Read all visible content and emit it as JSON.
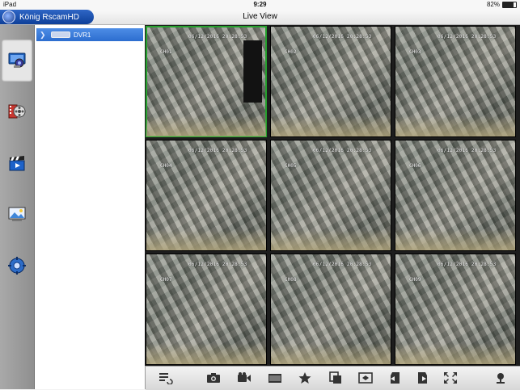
{
  "status_bar": {
    "device": "iPad",
    "time": "9:29",
    "battery": "82%"
  },
  "nav": {
    "app_name": "König RscamHD",
    "title": "Live View"
  },
  "sidebar": {
    "items": [
      {
        "id": "live-view",
        "icon": "monitor-icon",
        "active": true
      },
      {
        "id": "playback",
        "icon": "film-reel-icon",
        "active": false
      },
      {
        "id": "video-files",
        "icon": "clapperboard-icon",
        "active": false
      },
      {
        "id": "image-files",
        "icon": "picture-icon",
        "active": false
      },
      {
        "id": "settings",
        "icon": "settings-gear-icon",
        "active": false
      }
    ]
  },
  "device_tree": {
    "devices": [
      {
        "name": "DVR1",
        "expanded": false
      }
    ]
  },
  "grid": {
    "cells": [
      {
        "channel": "CH01",
        "timestamp": "06/12/2016 20:28:53",
        "selected": true
      },
      {
        "channel": "CH02",
        "timestamp": "06/12/2016 20:28:53",
        "selected": false
      },
      {
        "channel": "CH03",
        "timestamp": "06/12/2016 20:28:53",
        "selected": false
      },
      {
        "channel": "CH04",
        "timestamp": "06/12/2016 20:28:53",
        "selected": false
      },
      {
        "channel": "CH05",
        "timestamp": "06/12/2016 20:28:53",
        "selected": false
      },
      {
        "channel": "CH06",
        "timestamp": "06/12/2016 20:28:53",
        "selected": false
      },
      {
        "channel": "CH07",
        "timestamp": "06/12/2016 20:28:53",
        "selected": false
      },
      {
        "channel": "CH08",
        "timestamp": "06/12/2016 20:28:53",
        "selected": false
      },
      {
        "channel": "CH09",
        "timestamp": "06/12/2016 20:28:53",
        "selected": false
      }
    ]
  },
  "toolbar": {
    "buttons": [
      "list-icon",
      "camera-icon",
      "video-record-icon",
      "folder-icon",
      "star-icon",
      "copy-icon",
      "window-icon",
      "page-left-icon",
      "page-right-icon",
      "fullscreen-icon",
      "ptz-icon"
    ]
  },
  "colors": {
    "accent": "#2c6dcf",
    "selected_border": "#25a12d"
  }
}
